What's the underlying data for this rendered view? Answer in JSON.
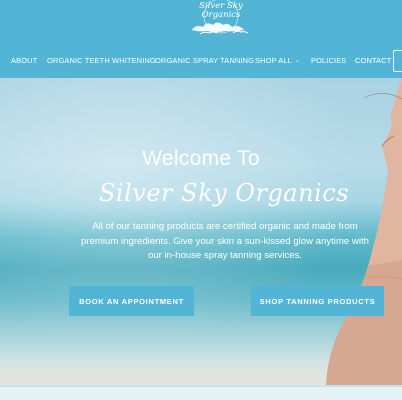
{
  "brand": {
    "logo_text": "Silver Sky Organics",
    "logo_icon": "cloud-icon"
  },
  "nav": {
    "items": [
      {
        "label": "ABOUT"
      },
      {
        "label": "ORGANIC TEETH WHITENING"
      },
      {
        "label": "ORGANIC SPRAY TANNING"
      },
      {
        "label": "SHOP ALL",
        "has_dropdown": true
      },
      {
        "label": "POLICIES"
      },
      {
        "label": "CONTACT"
      }
    ],
    "dropdown_icon": "chevron-down-icon"
  },
  "hero": {
    "welcome": "Welcome To",
    "brand_name": "Silver Sky Organics",
    "description": "All of our tanning products are certified organic and made from premium ingredients. Give your skin a sun-kissed glow anytime with our in-house spray tanning services.",
    "buttons": {
      "book": "BOOK AN APPOINTMENT",
      "shop": "SHOP TANNING PRODUCTS"
    }
  },
  "colors": {
    "accent": "#52b5d6",
    "text_on_accent": "#ffffff"
  }
}
